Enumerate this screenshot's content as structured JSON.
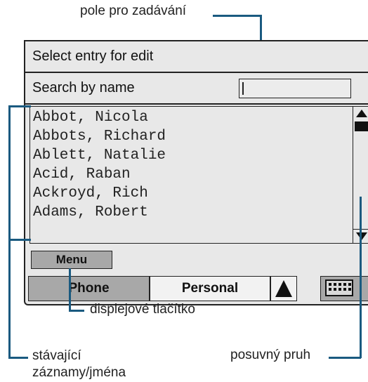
{
  "callouts": {
    "input_field": "pole pro zadávání",
    "display_button": "displejové tlačítko",
    "existing_entries": "stávající\nzáznamy/jména",
    "scrollbar": "posuvný pruh"
  },
  "screen": {
    "title": "Select entry for edit",
    "search_label": "Search by name",
    "search_value": "",
    "entries": [
      "Abbot, Nicola",
      "Abbots, Richard",
      "Ablett, Natalie",
      "Acid, Raban",
      "Ackroyd, Rich",
      "Adams, Robert"
    ],
    "menu_button": "Menu",
    "tabs": [
      "Phone",
      "Personal"
    ],
    "icons": [
      "scroll-up-arrow-icon",
      "scroll-thumb-icon",
      "scroll-down-arrow-icon",
      "page-up-arrow-icon",
      "keyboard-icon"
    ]
  }
}
